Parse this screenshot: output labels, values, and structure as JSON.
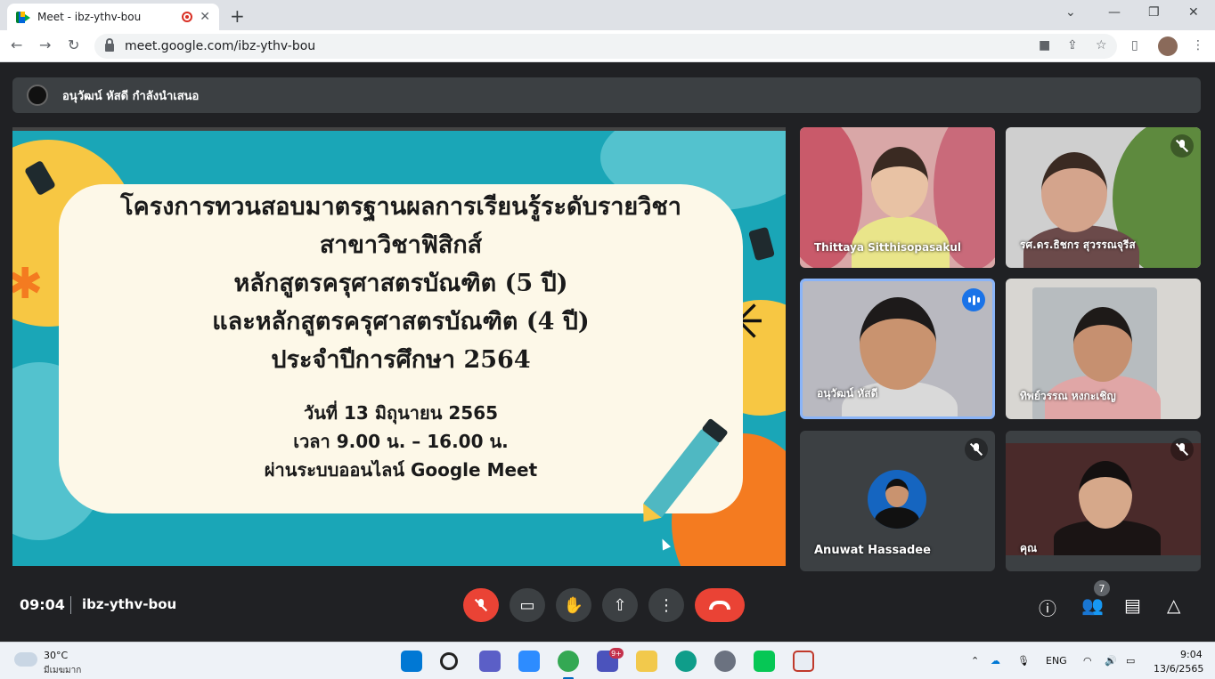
{
  "browser": {
    "tab_title": "Meet - ibz-ythv-bou",
    "tab_close": "✕",
    "new_tab": "+",
    "url": "meet.google.com/ibz-ythv-bou"
  },
  "presenter": {
    "text": "อนุวัฒน์ หัสดี กำลังนำเสนอ"
  },
  "slide": {
    "title_lines": [
      "โครงการทวนสอบมาตรฐานผลการเรียนรู้ระดับรายวิชา",
      "สาขาวิชาฟิสิกส์",
      "หลักสูตรครุศาสตรบัณฑิต (5 ปี)",
      "และหลักสูตรครุศาสตรบัณฑิต (4 ปี)",
      "ประจำปีการศึกษา 2564"
    ],
    "info_lines": [
      "วันที่ 13 มิถุนายน 2565",
      "เวลา 9.00 น. – 16.00 น.",
      "ผ่านระบบออนไลน์ Google Meet"
    ]
  },
  "participants": [
    {
      "name": "Thittaya Sitthisopasakul",
      "muted": false
    },
    {
      "name": "รศ.ดร.ธิชกร สุวรรณจุรีส",
      "muted": true
    },
    {
      "name": "อนุวัฒน์ หัสดี",
      "muted": false,
      "speaking": true
    },
    {
      "name": "ทิพย์วรรณ หงกะเชิญ",
      "muted": false
    },
    {
      "name": "Anuwat Hassadee",
      "muted": true
    },
    {
      "name": "คุณ",
      "muted": true
    }
  ],
  "bottom_bar": {
    "time": "09:04",
    "meeting_code": "ibz-ythv-bou",
    "people_count": "7"
  },
  "taskbar": {
    "temperature": "30°C",
    "weather": "มีเมฆมาก",
    "teams_badge": "9+",
    "language": "ENG",
    "time": "9:04",
    "date": "13/6/2565"
  },
  "colors": {
    "meet_background": "#202124",
    "tile_background": "#3c4043",
    "end_call_red": "#ea4335",
    "speaking_blue": "#1a73e8",
    "slide_teal": "#1aa6b7"
  }
}
